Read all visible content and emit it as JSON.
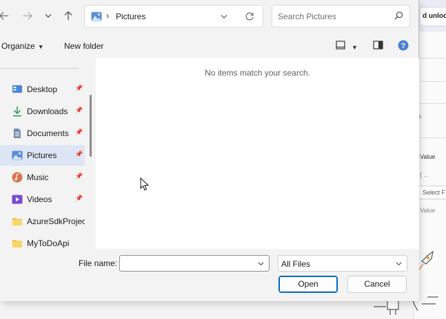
{
  "background_app": {
    "unlock_label": "d unlock",
    "section_text": "s",
    "value_header": "Value",
    "placeholder_row": "{ ...",
    "select_label": "Select F",
    "value_placeholder": "Value"
  },
  "dialog": {
    "address": {
      "crumb": "Pictures"
    },
    "search": {
      "placeholder": "Search Pictures"
    },
    "commands": {
      "organize": "Organize",
      "new_folder": "New folder"
    },
    "nav_items": [
      {
        "label": "Desktop",
        "icon": "desktop-icon",
        "pinned": true
      },
      {
        "label": "Downloads",
        "icon": "download-icon",
        "pinned": true
      },
      {
        "label": "Documents",
        "icon": "document-icon",
        "pinned": true
      },
      {
        "label": "Pictures",
        "icon": "pictures-icon",
        "pinned": true,
        "selected": true
      },
      {
        "label": "Music",
        "icon": "music-icon",
        "pinned": true
      },
      {
        "label": "Videos",
        "icon": "video-icon",
        "pinned": true
      },
      {
        "label": "AzureSdkProject",
        "icon": "folder-icon",
        "pinned": false
      },
      {
        "label": "MyToDoApi",
        "icon": "folder-icon",
        "pinned": false
      }
    ],
    "empty_message": "No items match your search.",
    "file_name_label": "File name:",
    "file_name_value": "",
    "file_type": "All Files",
    "open_button": "Open",
    "cancel_button": "Cancel"
  },
  "colors": {
    "accent": "#0067c0",
    "selected_bg": "#dde6f5",
    "folder": "#f2c94c"
  }
}
